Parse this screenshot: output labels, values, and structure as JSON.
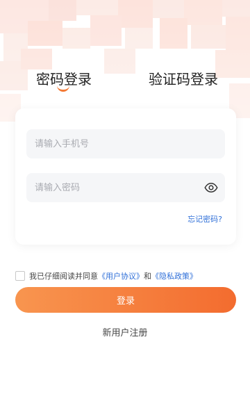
{
  "tabs": {
    "password_login": "密码登录",
    "code_login": "验证码登录",
    "active": "password_login"
  },
  "form": {
    "phone_placeholder": "请输入手机号",
    "password_placeholder": "请输入密码",
    "forgot_password": "忘记密码?"
  },
  "agreement": {
    "prefix": "我已仔细阅读并同意",
    "user_agreement": "《用户协议》",
    "and": "和",
    "privacy_policy": "《隐私政策》"
  },
  "login_button": "登录",
  "register_link": "新用户注册",
  "icons": {
    "password_visibility": "eye-icon"
  },
  "colors": {
    "accent": "#f47a35",
    "button_start": "#f8954f",
    "button_end": "#f36c2f",
    "link": "#2f6fd8",
    "field_bg": "#f5f6f8"
  }
}
